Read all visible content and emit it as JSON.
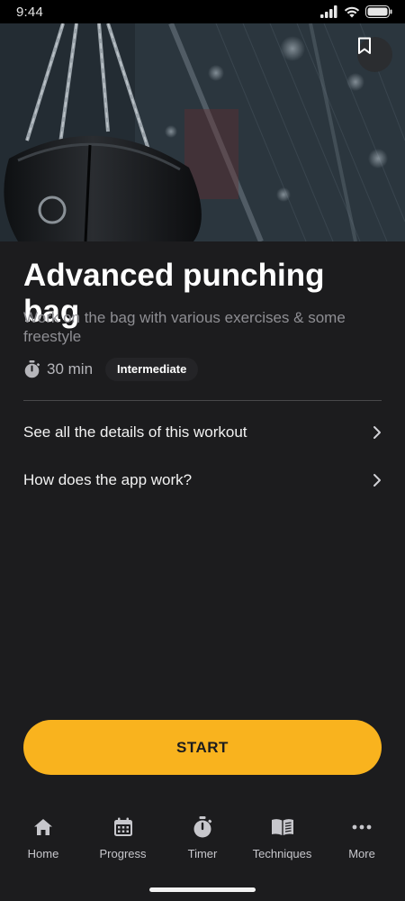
{
  "status_bar": {
    "time": "9:44"
  },
  "hero": {
    "bookmark_icon": "bookmark-icon"
  },
  "workout": {
    "title": "Advanced punching bag",
    "description": "Work on the bag with various exercises & some freestyle",
    "duration": "30 min",
    "level": "Intermediate"
  },
  "links": [
    {
      "label": "See all the details of this workout",
      "icon": "chevron-right-icon"
    },
    {
      "label": "How does the app work?",
      "icon": "chevron-right-icon"
    }
  ],
  "start_button": {
    "label": "START"
  },
  "bottom_nav": [
    {
      "label": "Home",
      "icon": "home-icon"
    },
    {
      "label": "Progress",
      "icon": "calendar-icon"
    },
    {
      "label": "Timer",
      "icon": "stopwatch-icon"
    },
    {
      "label": "Techniques",
      "icon": "book-icon"
    },
    {
      "label": "More",
      "icon": "more-dots-icon"
    }
  ],
  "colors": {
    "background": "#1c1c1e",
    "accent": "#f9b31e",
    "secondary_text": "#8e8e93",
    "badge_bg": "#242427"
  }
}
